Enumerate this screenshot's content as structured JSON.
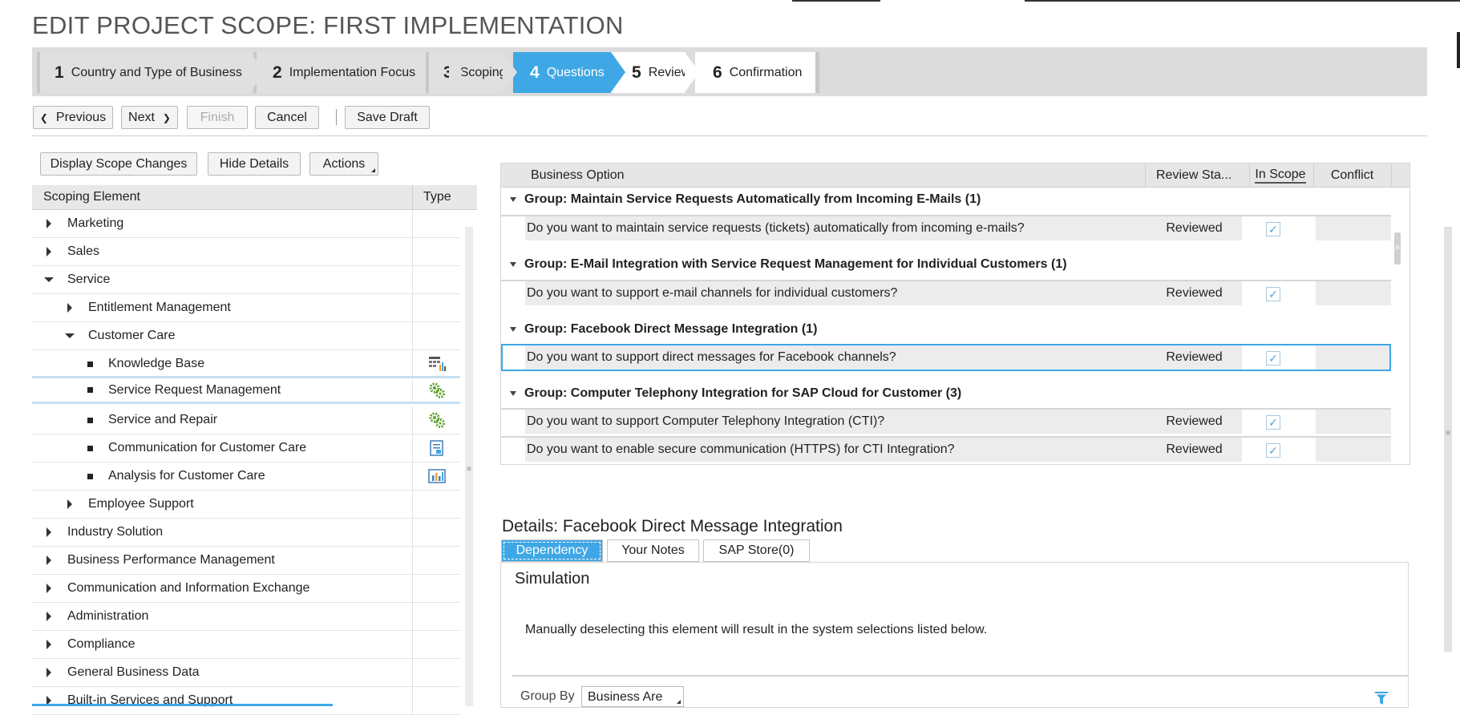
{
  "page_title": "EDIT PROJECT SCOPE: FIRST IMPLEMENTATION",
  "wizard": {
    "steps": [
      {
        "num": "1",
        "label": "Country and Type of Business"
      },
      {
        "num": "2",
        "label": "Implementation Focus"
      },
      {
        "num": "3",
        "label": "Scoping"
      },
      {
        "num": "4",
        "label": "Questions"
      },
      {
        "num": "5",
        "label": "Review"
      },
      {
        "num": "6",
        "label": "Confirmation"
      }
    ],
    "active_step": 4
  },
  "toolbar": {
    "previous": "Previous",
    "next": "Next",
    "finish": "Finish",
    "cancel": "Cancel",
    "save_draft": "Save Draft"
  },
  "left": {
    "buttons": {
      "display_scope_changes": "Display Scope Changes",
      "hide_details": "Hide Details",
      "actions": "Actions"
    },
    "headers": {
      "element": "Scoping Element",
      "type": "Type"
    },
    "rows": [
      {
        "label": "Marketing",
        "level": 0,
        "state": "collapsed",
        "icon": ""
      },
      {
        "label": "Sales",
        "level": 0,
        "state": "collapsed",
        "icon": ""
      },
      {
        "label": "Service",
        "level": 0,
        "state": "expanded",
        "icon": ""
      },
      {
        "label": "Entitlement Management",
        "level": 1,
        "state": "collapsed",
        "icon": ""
      },
      {
        "label": "Customer Care",
        "level": 1,
        "state": "expanded",
        "icon": ""
      },
      {
        "label": "Knowledge Base",
        "level": 2,
        "state": "leaf",
        "icon": "table-chart-icon"
      },
      {
        "label": "Service Request Management",
        "level": 2,
        "state": "leaf",
        "icon": "gears-icon"
      },
      {
        "label": "Service and Repair",
        "level": 2,
        "state": "leaf",
        "icon": "gears-icon"
      },
      {
        "label": "Communication for Customer Care",
        "level": 2,
        "state": "leaf",
        "icon": "document-icon"
      },
      {
        "label": "Analysis for Customer Care",
        "level": 2,
        "state": "leaf",
        "icon": "bar-chart-icon"
      },
      {
        "label": "Employee Support",
        "level": 1,
        "state": "collapsed",
        "icon": ""
      },
      {
        "label": "Industry Solution",
        "level": 0,
        "state": "collapsed",
        "icon": ""
      },
      {
        "label": "Business Performance Management",
        "level": 0,
        "state": "collapsed",
        "icon": ""
      },
      {
        "label": "Communication and Information Exchange",
        "level": 0,
        "state": "collapsed",
        "icon": ""
      },
      {
        "label": "Administration",
        "level": 0,
        "state": "collapsed",
        "icon": ""
      },
      {
        "label": "Compliance",
        "level": 0,
        "state": "collapsed",
        "icon": ""
      },
      {
        "label": "General Business Data",
        "level": 0,
        "state": "collapsed",
        "icon": ""
      },
      {
        "label": "Built-in Services and Support",
        "level": 0,
        "state": "collapsed",
        "icon": ""
      }
    ],
    "selected_row": "Service Request Management"
  },
  "questions_table": {
    "headers": {
      "option": "Business Option",
      "review_status": "Review Sta...",
      "in_scope": "In Scope",
      "conflict": "Conflict"
    },
    "groups": [
      {
        "title": "Group: Maintain Service Requests Automatically from Incoming E-Mails (1)",
        "questions": [
          {
            "text": "Do you want to maintain service requests (tickets) automatically from incoming e-mails?",
            "status": "Reviewed",
            "in_scope": true
          }
        ]
      },
      {
        "title": "Group: E-Mail Integration with Service Request Management for Individual Customers (1)",
        "questions": [
          {
            "text": "Do you want to support e-mail channels for individual customers?",
            "status": "Reviewed",
            "in_scope": true
          }
        ]
      },
      {
        "title": "Group: Facebook Direct Message Integration (1)",
        "questions": [
          {
            "text": "Do you want to support direct messages for Facebook channels?",
            "status": "Reviewed",
            "in_scope": true
          }
        ]
      },
      {
        "title": "Group: Computer Telephony Integration for SAP Cloud for Customer (3)",
        "questions": [
          {
            "text": "Do you want to support Computer Telephony Integration (CTI)?",
            "status": "Reviewed",
            "in_scope": true
          },
          {
            "text": "Do you want to enable secure communication (HTTPS) for CTI Integration?",
            "status": "Reviewed",
            "in_scope": true
          }
        ]
      }
    ],
    "selected_question": "Do you want to support direct messages for Facebook channels?",
    "checkmark": "✓"
  },
  "details": {
    "title": "Details: Facebook Direct Message Integration",
    "tabs": [
      "Dependency",
      "Your Notes",
      "SAP Store(0)"
    ],
    "active_tab": "Dependency",
    "section_title": "Simulation",
    "message": "Manually deselecting this element will result in the system selections listed below.",
    "group_by_label": "Group By",
    "group_by_value": "Business Are"
  },
  "colors": {
    "accent": "#3fa7e5",
    "wizard_bg": "#dcdcdc",
    "green_icon": "#5aa02c"
  }
}
